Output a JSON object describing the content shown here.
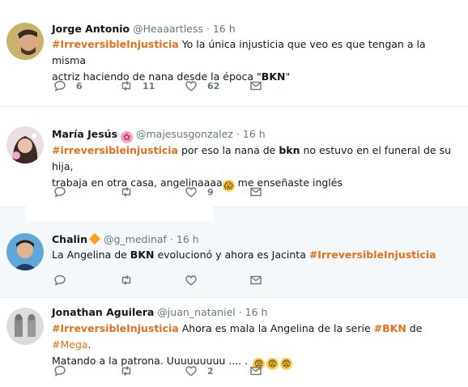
{
  "tweets": [
    {
      "name": "Jorge Antonio",
      "handle": "@Heaaartless",
      "time": "· 16 h",
      "text_parts": [
        "#IrreversibleInjusticia",
        " Yo la única injusticia que veo es que tengan a la misma",
        "actriz haciendo de nana desde la época \"",
        "BKN",
        "\""
      ],
      "replies": "6",
      "retweets": "11",
      "likes": "62"
    },
    {
      "name": "María Jesús",
      "handle": "@majesusgonzalez",
      "time": "· 16 h",
      "text_parts": [
        "#irreversibleinjusticia",
        " por eso la nana de ",
        "bkn",
        " no estuvo en el funeral de su hija,",
        "trabaja en otra casa, angelinaaaa",
        " me enseñaste inglés"
      ],
      "replies": "",
      "retweets": "",
      "likes": "9"
    },
    {
      "name": "Chalin",
      "handle": "@g_medinaf",
      "time": "· 16 h",
      "text_parts": [
        "La Angelina de ",
        "BKN",
        " evolucionó y ahora es Jacinta ",
        "#IrreversibleInjusticia"
      ],
      "replies": "",
      "retweets": "",
      "likes": ""
    },
    {
      "name": "Jonathan Aguilera",
      "handle": "@juan_nataniel",
      "time": "· 16 h",
      "text_parts": [
        "#IrreversibleInjusticia",
        " Ahora es mala la Angelina de la serie ",
        "#BKN",
        " de ",
        "#Mega",
        ".",
        "Matando a la patrona. Uuuuuuuuu .... ."
      ],
      "replies": "",
      "retweets": "",
      "likes": "2"
    }
  ],
  "colors": {
    "hashtag": "#e8701a",
    "muted": "#657786",
    "alt_bg": "#f5f8fa"
  },
  "icons": {
    "reply": "reply-icon",
    "retweet": "retweet-icon",
    "like": "heart-icon",
    "dm": "envelope-icon"
  }
}
